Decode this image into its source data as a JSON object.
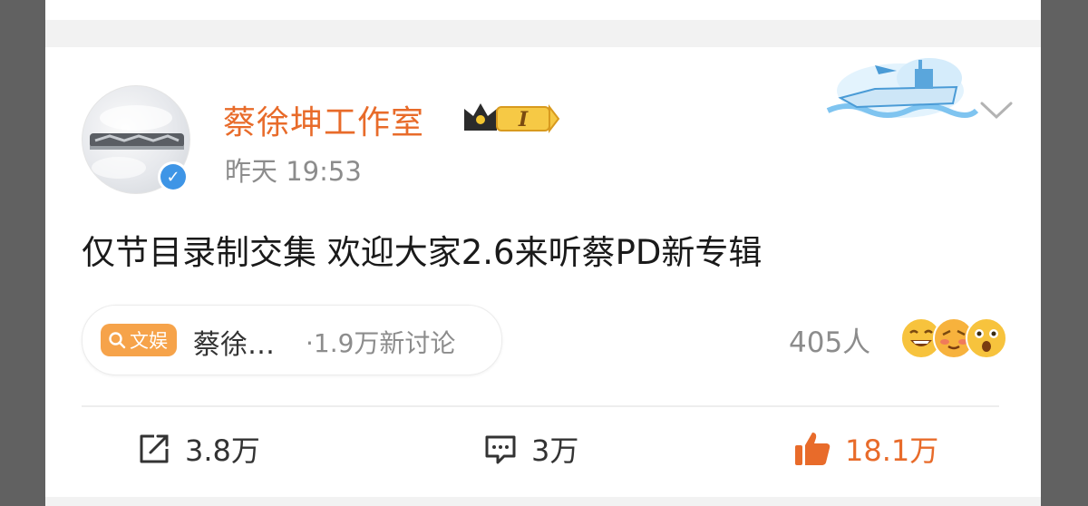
{
  "post": {
    "author": "蔡徐坤工作室",
    "member_level": "I",
    "timestamp": "昨天 19:53",
    "text": "仅节目录制交集 欢迎大家2.6来听蔡PD新专辑"
  },
  "topic": {
    "tag_label": "文娱",
    "name": "蔡徐…",
    "discussion_count": "·1.9万新讨论"
  },
  "reactions": {
    "people_count": "405人",
    "emojis": [
      "laughing-emoji",
      "blushing-emoji",
      "surprised-emoji"
    ]
  },
  "actions": {
    "share_count": "3.8万",
    "comment_count": "3万",
    "like_count": "18.1万"
  },
  "colors": {
    "accent_orange": "#e86b2a",
    "verify_blue": "#3e95e6",
    "tag_orange": "#f6a34a",
    "muted_gray": "#8c8c8c"
  }
}
